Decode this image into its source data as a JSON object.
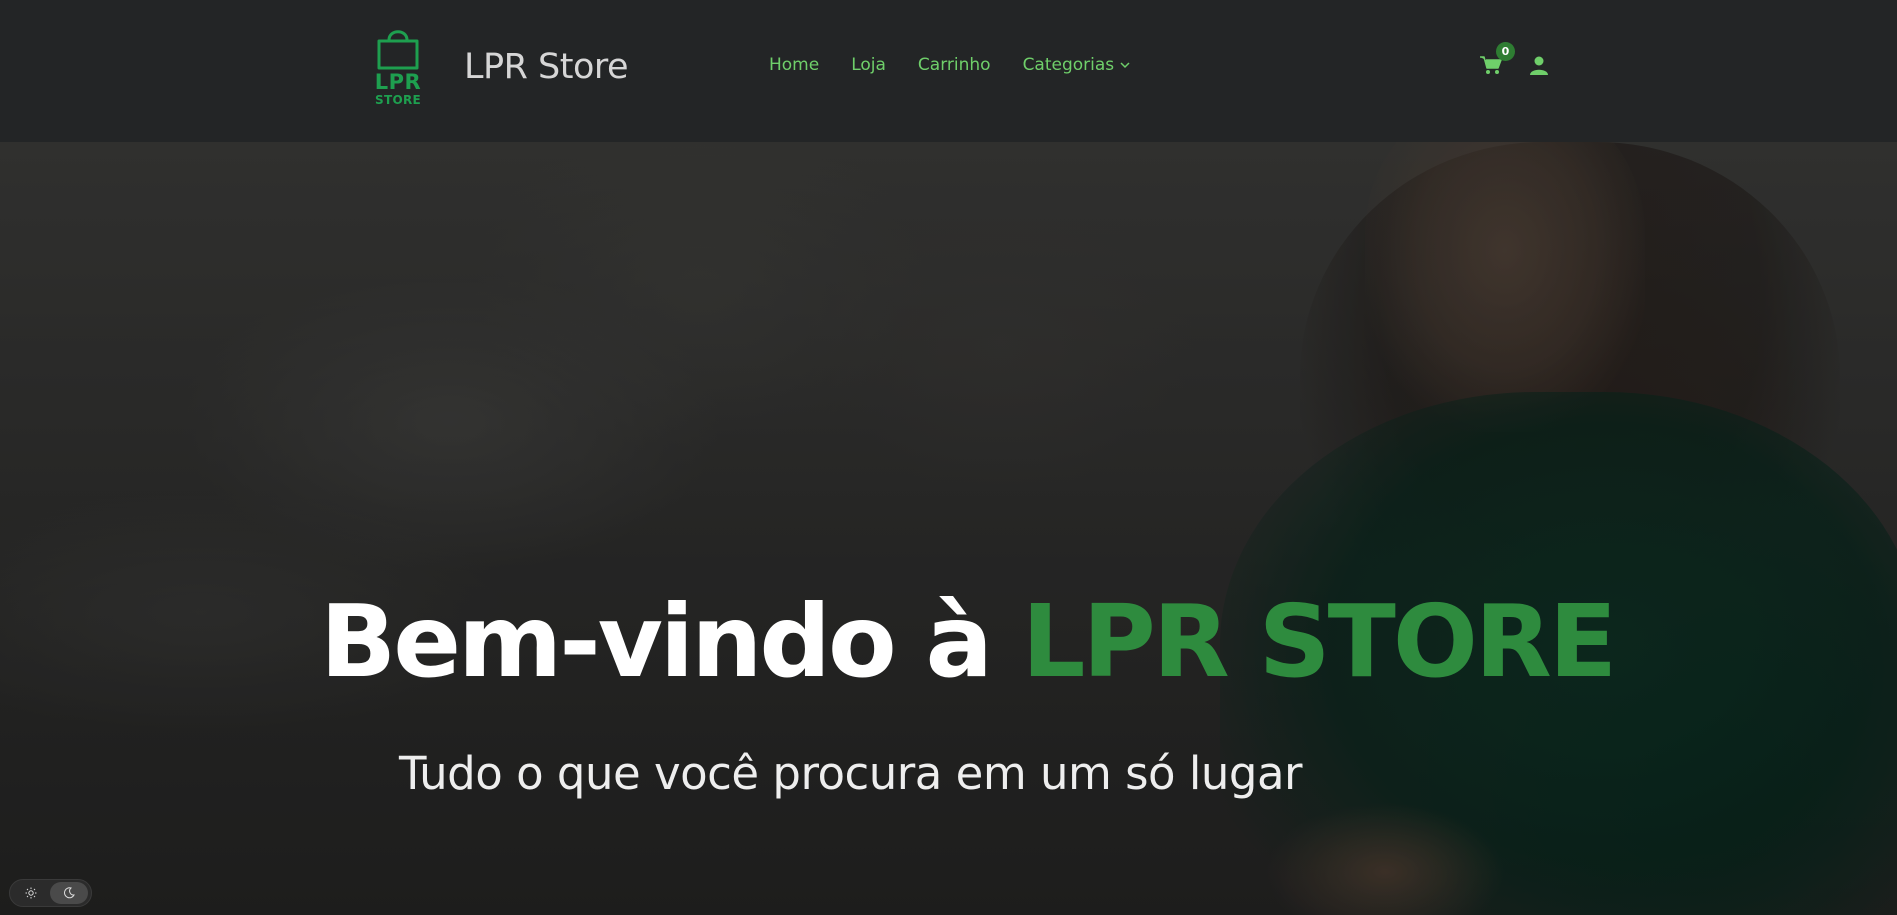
{
  "brand": {
    "logo_line1": "LPR",
    "logo_line2": "STORE",
    "name": "LPR Store",
    "icon": "shopping-bag-icon"
  },
  "nav": {
    "items": [
      {
        "label": "Home"
      },
      {
        "label": "Loja"
      },
      {
        "label": "Carrinho"
      },
      {
        "label": "Categorias"
      }
    ]
  },
  "header_actions": {
    "cart_count": "0",
    "cart_icon": "shopping-cart-icon",
    "user_icon": "user-icon"
  },
  "hero": {
    "title_prefix": "Bem-vindo à ",
    "title_accent": "LPR STORE",
    "subtitle": "Tudo o que você procura em um só lugar"
  },
  "theme_toggle": {
    "light_icon": "sun-icon",
    "dark_icon": "moon-icon",
    "selected": "dark"
  },
  "colors": {
    "accent_green": "#2e8b3e",
    "nav_link": "#6fcf6a",
    "logo_green": "#1e9f4f",
    "header_bg": "#232526"
  }
}
